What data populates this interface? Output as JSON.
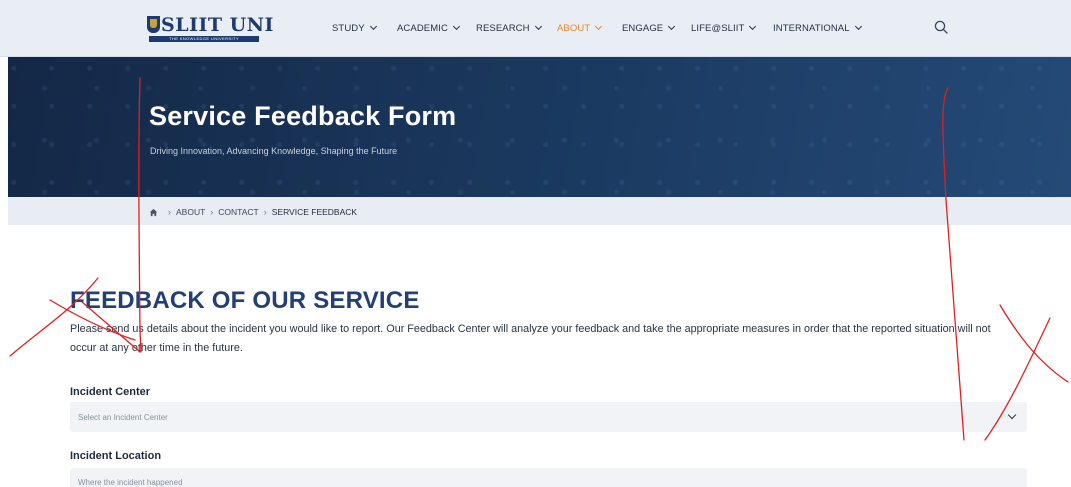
{
  "nav": {
    "logo": {
      "main": "SLIIT UNI",
      "sub": "THE KNOWLEDGE UNIVERSITY"
    },
    "items": [
      {
        "label": "STUDY",
        "active": false
      },
      {
        "label": "ACADEMIC",
        "active": false
      },
      {
        "label": "RESEARCH",
        "active": false
      },
      {
        "label": "ABOUT",
        "active": true
      },
      {
        "label": "ENGAGE",
        "active": false
      },
      {
        "label": "LIFE@SLIIT",
        "active": false
      },
      {
        "label": "INTERNATIONAL",
        "active": false
      }
    ],
    "search_icon": "search-icon"
  },
  "hero": {
    "title": "Service Feedback Form",
    "subtitle": "Driving Innovation, Advancing Knowledge, Shaping the Future"
  },
  "breadcrumb": {
    "home_icon": "home-icon",
    "items": [
      "ABOUT",
      "CONTACT",
      "SERVICE FEEDBACK"
    ]
  },
  "main": {
    "heading": "FEEDBACK OF OUR SERVICE",
    "intro": "Please send us details about the incident you would like to report. Our Feedback Center will analyze your feedback and take the appropriate measures in order that the reported situation will not occur at any other time in the future.",
    "incident_center": {
      "label": "Incident Center",
      "placeholder": "Select an Incident Center"
    },
    "incident_location": {
      "label": "Incident Location",
      "placeholder": "Where the incident happened"
    }
  },
  "colors": {
    "accent": "#e8862a",
    "navy": "#233f73",
    "hero_bg": "#1b3a61",
    "annotation": "#e02020"
  }
}
